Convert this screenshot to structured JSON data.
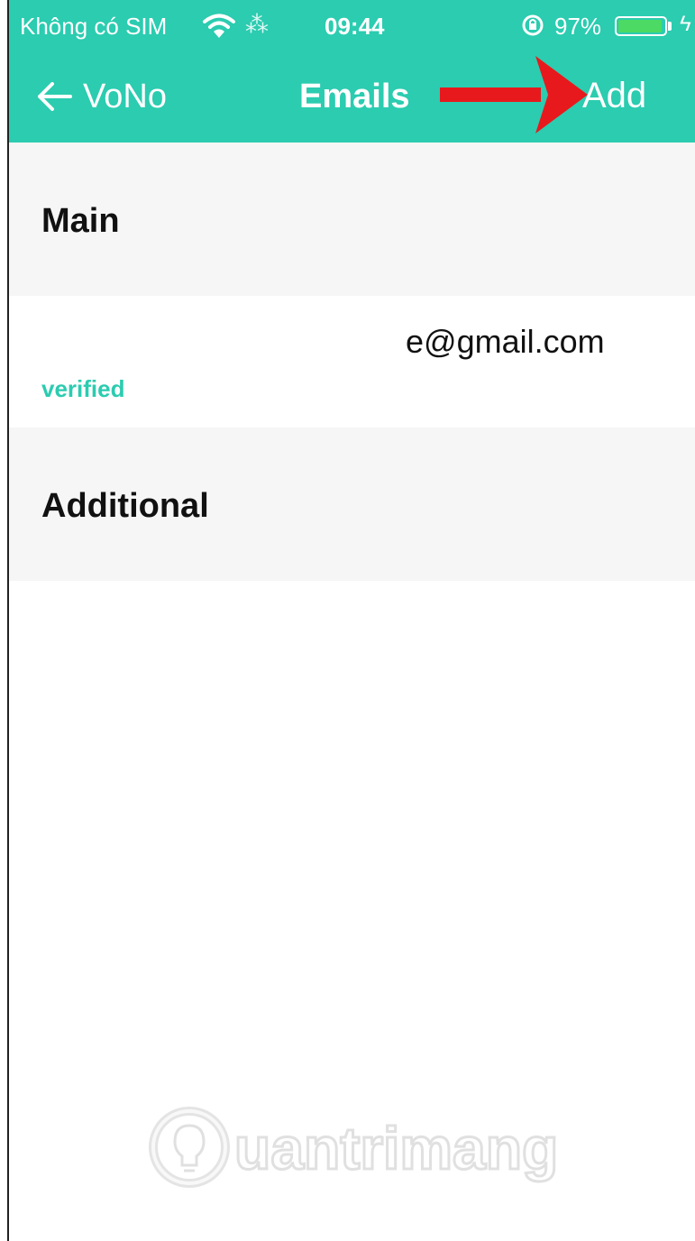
{
  "status_bar": {
    "carrier": "Không có SIM",
    "time": "09:44",
    "battery": "97%",
    "battery_level": 0.97
  },
  "nav": {
    "back_label": "VoNo",
    "title": "Emails",
    "add_label": "Add"
  },
  "sections": {
    "main_label": "Main",
    "additional_label": "Additional"
  },
  "email": {
    "address": "e@gmail.com",
    "status": "verified"
  },
  "watermark": {
    "text": "Quantrimang"
  },
  "colors": {
    "header": "#2bccb0",
    "verified": "#2bccb0",
    "annotation_arrow": "#e8191c"
  },
  "icons": [
    "wifi-icon",
    "loading-icon",
    "rotation-lock-icon",
    "battery-icon",
    "charging-icon",
    "back-arrow-icon",
    "annotation-arrow"
  ]
}
